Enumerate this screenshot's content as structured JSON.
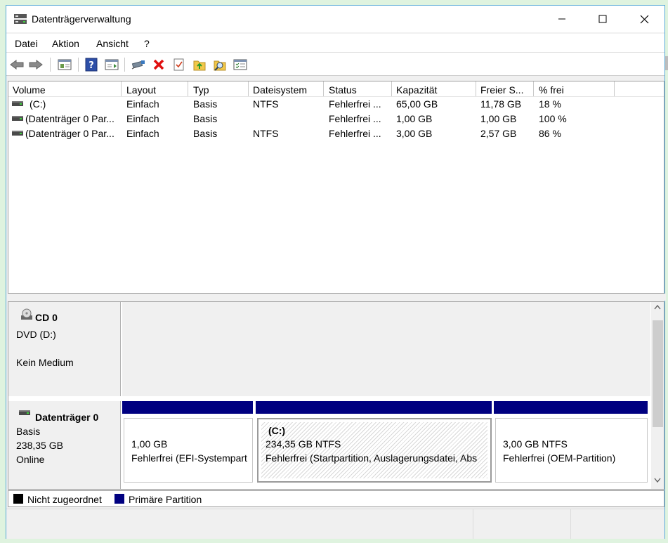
{
  "window": {
    "title": "Datenträgerverwaltung"
  },
  "menu": {
    "file": "Datei",
    "action": "Aktion",
    "view": "Ansicht",
    "help": "?"
  },
  "colors": {
    "primary_partition": "#000080",
    "unallocated": "#000000",
    "accent_border": "#58a9d6"
  },
  "toolbar": {
    "icons": [
      "back-icon",
      "forward-icon",
      "properties-icon",
      "help-icon",
      "show-hide-icon",
      "connect-icon",
      "delete-icon",
      "check-icon",
      "folder-up-icon",
      "search-folder-icon",
      "list-icon"
    ]
  },
  "volumes": {
    "columns": [
      "Volume",
      "Layout",
      "Typ",
      "Dateisystem",
      "Status",
      "Kapazität",
      "Freier S...",
      "% frei"
    ],
    "rows": [
      {
        "volume": "(C:)",
        "layout": "Einfach",
        "type": "Basis",
        "fs": "NTFS",
        "status": "Fehlerfrei ...",
        "capacity": "65,00 GB",
        "free": "11,78 GB",
        "pct": "18 %"
      },
      {
        "volume": "(Datenträger 0 Par...",
        "layout": "Einfach",
        "type": "Basis",
        "fs": "",
        "status": "Fehlerfrei ...",
        "capacity": "1,00 GB",
        "free": "1,00 GB",
        "pct": "100 %"
      },
      {
        "volume": "(Datenträger 0 Par...",
        "layout": "Einfach",
        "type": "Basis",
        "fs": "NTFS",
        "status": "Fehlerfrei ...",
        "capacity": "3,00 GB",
        "free": "2,57 GB",
        "pct": "86 %"
      }
    ]
  },
  "disks": {
    "cd": {
      "name": "CD 0",
      "type": "DVD (D:)",
      "status": "Kein Medium"
    },
    "disk0": {
      "name": "Datenträger 0",
      "type": "Basis",
      "size": "238,35 GB",
      "status": "Online",
      "partitions": [
        {
          "title": "",
          "size": "1,00 GB",
          "status": "Fehlerfrei (EFI-Systempart"
        },
        {
          "title": "(C:)",
          "size": "234,35 GB NTFS",
          "status": "Fehlerfrei (Startpartition, Auslagerungsdatei, Abs"
        },
        {
          "title": "",
          "size": "3,00 GB NTFS",
          "status": "Fehlerfrei (OEM-Partition)"
        }
      ]
    }
  },
  "legend": {
    "unallocated": "Nicht zugeordnet",
    "primary": "Primäre Partition"
  }
}
